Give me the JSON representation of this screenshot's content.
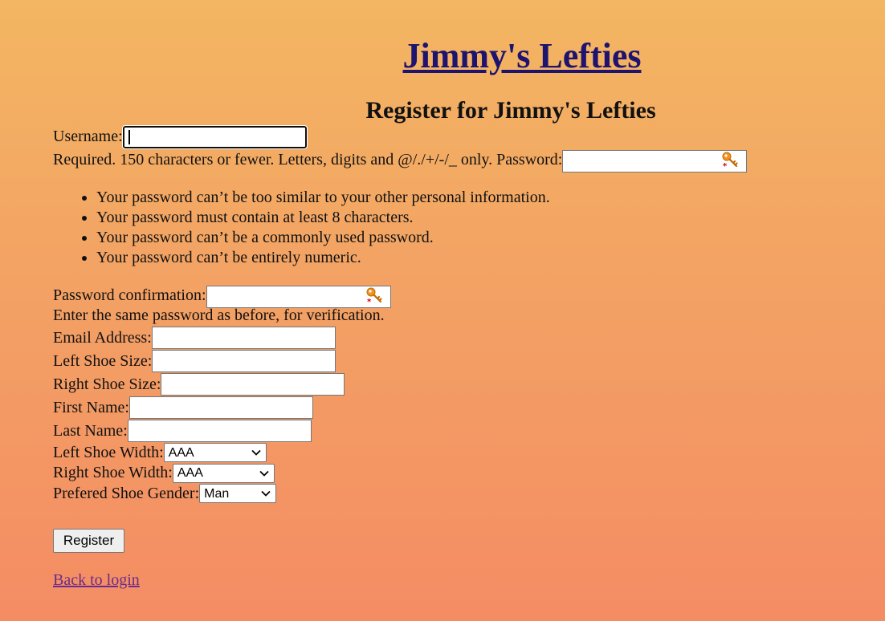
{
  "site": {
    "title": "Jimmy's Lefties"
  },
  "page": {
    "heading": "Register for Jimmy's Lefties"
  },
  "form": {
    "username": {
      "label": "Username:",
      "value": "",
      "help": "Required. 150 characters or fewer. Letters, digits and @/./+/-/_ only."
    },
    "password": {
      "label": "Password:",
      "value": "",
      "requirements": [
        "Your password can’t be too similar to your other personal information.",
        "Your password must contain at least 8 characters.",
        "Your password can’t be a commonly used password.",
        "Your password can’t be entirely numeric."
      ]
    },
    "password_confirmation": {
      "label": "Password confirmation:",
      "value": "",
      "help": "Enter the same password as before, for verification."
    },
    "email": {
      "label": "Email Address:",
      "value": ""
    },
    "left_shoe_size": {
      "label": "Left Shoe Size:",
      "value": ""
    },
    "right_shoe_size": {
      "label": "Right Shoe Size:",
      "value": ""
    },
    "first_name": {
      "label": "First Name:",
      "value": ""
    },
    "last_name": {
      "label": "Last Name:",
      "value": ""
    },
    "left_shoe_width": {
      "label": "Left Shoe Width:",
      "selected": "AAA"
    },
    "right_shoe_width": {
      "label": "Right Shoe Width:",
      "selected": "AAA"
    },
    "preferred_shoe_gender": {
      "label": "Prefered Shoe Gender:",
      "selected": "Man"
    },
    "submit_label": "Register"
  },
  "links": {
    "back_to_login": "Back to login"
  },
  "icons": {
    "password_manager": "key-icon"
  },
  "colors": {
    "gradient_top": "#f3b662",
    "gradient_bottom": "#f48c64",
    "title_link": "#1e1470",
    "visited_link": "#6a2c8a"
  }
}
